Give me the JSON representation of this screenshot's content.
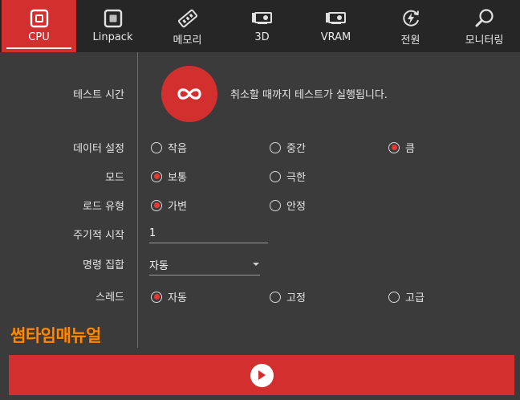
{
  "tabs": [
    {
      "label": "CPU",
      "icon": "cpu-icon",
      "active": true
    },
    {
      "label": "Linpack",
      "icon": "linpack-icon",
      "active": false
    },
    {
      "label": "메모리",
      "icon": "memory-icon",
      "active": false
    },
    {
      "label": "3D",
      "icon": "gpu-3d-icon",
      "active": false
    },
    {
      "label": "VRAM",
      "icon": "vram-icon",
      "active": false
    },
    {
      "label": "전원",
      "icon": "power-icon",
      "active": false
    },
    {
      "label": "모니터링",
      "icon": "monitoring-icon",
      "active": false
    }
  ],
  "test_time": {
    "label": "테스트 시간",
    "icon": "infinity-icon",
    "description": "취소할 때까지 테스트가 실행됩니다."
  },
  "data_setting": {
    "label": "데이터 설정",
    "options": [
      "작음",
      "중간",
      "큼"
    ],
    "selected": 2
  },
  "mode": {
    "label": "모드",
    "options": [
      "보통",
      "극한"
    ],
    "selected": 0
  },
  "load_type": {
    "label": "로드 유형",
    "options": [
      "가변",
      "안정"
    ],
    "selected": 0
  },
  "periodic_start": {
    "label": "주기적 시작",
    "value": "1"
  },
  "instruction_set": {
    "label": "명령 집합",
    "value": "자동"
  },
  "threads": {
    "label": "스레드",
    "options": [
      "자동",
      "고정",
      "고급"
    ],
    "selected": 0
  },
  "watermark": "썸타임매뉴얼",
  "start_button": {
    "icon": "play-icon"
  },
  "colors": {
    "accent": "#d32f2f",
    "background": "#3b3b3b",
    "tabbar": "#262626",
    "watermark": "#ff8a00"
  }
}
